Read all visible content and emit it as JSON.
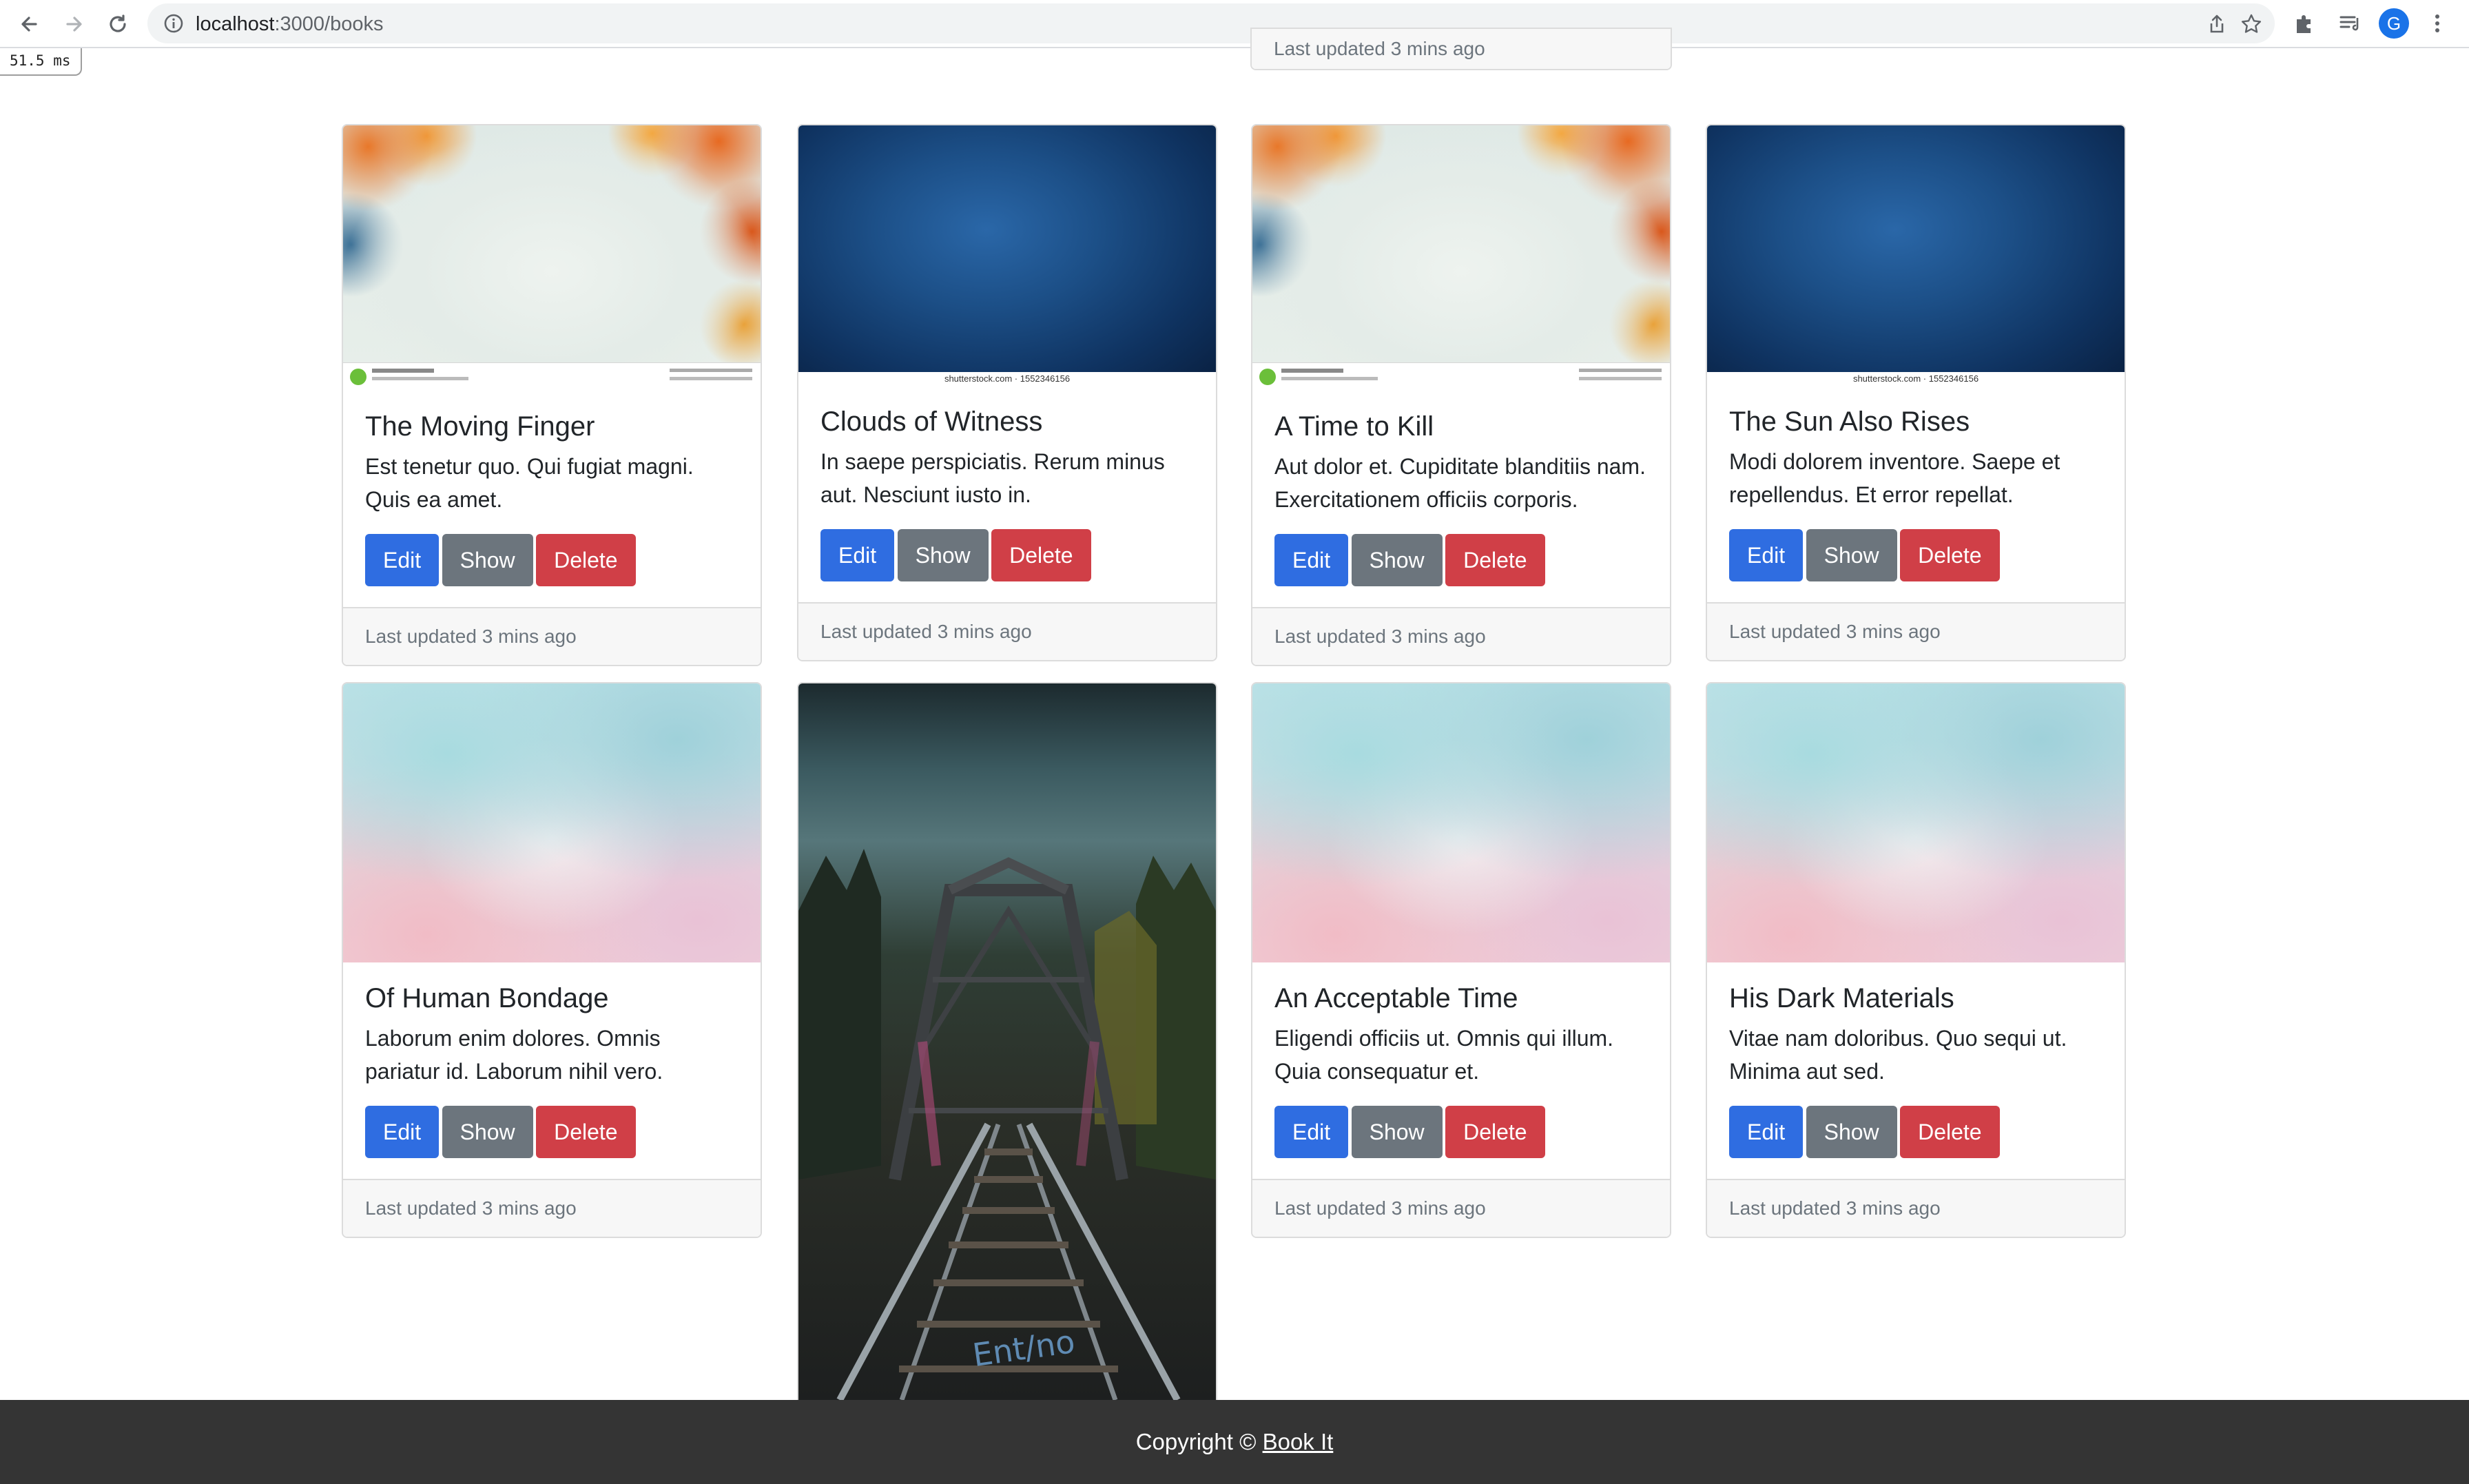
{
  "browser": {
    "url_host": "localhost",
    "url_path": ":3000/books",
    "avatar_letter": "G",
    "timing": "51.5 ms"
  },
  "top_partial_card": {
    "footer": "Last updated 3 mins ago"
  },
  "buttons": {
    "edit": "Edit",
    "show": "Show",
    "delete": "Delete"
  },
  "books": [
    {
      "title": "The Moving Finger",
      "text": "Est tenetur quo. Qui fugiat magni. Quis ea amet.",
      "updated": "Last updated 3 mins ago",
      "image": "autumn-leaves"
    },
    {
      "title": "Clouds of Witness",
      "text": "In saepe perspiciatis. Rerum minus aut. Nesciunt iusto in.",
      "updated": "Last updated 3 mins ago",
      "image": "blue-texture",
      "image_caption": "shutterstock.com · 1552346156"
    },
    {
      "title": "A Time to Kill",
      "text": "Aut dolor et. Cupiditate blanditiis nam. Exercitationem officiis corporis.",
      "updated": "Last updated 3 mins ago",
      "image": "autumn-leaves"
    },
    {
      "title": "The Sun Also Rises",
      "text": "Modi dolorem inventore. Saepe et repellendus. Et error repellat.",
      "updated": "Last updated 3 mins ago",
      "image": "blue-texture",
      "image_caption": "shutterstock.com · 1552346156"
    },
    {
      "title": "Of Human Bondage",
      "text": "Laborum enim dolores. Omnis pariatur id. Laborum nihil vero.",
      "updated": "Last updated 3 mins ago",
      "image": "pastel-clouds"
    },
    {
      "title": "An Acceptable Time",
      "text": "Eligendi officiis ut. Omnis qui illum. Quia consequatur et.",
      "updated": "Last updated 3 mins ago",
      "image": "pastel-clouds"
    },
    {
      "title": "His Dark Materials",
      "text": "Vitae nam doloribus. Quo sequi ut. Minima aut sed.",
      "updated": "Last updated 3 mins ago",
      "image": "pastel-clouds"
    }
  ],
  "bridge_card": {
    "image": "railway-bridge"
  },
  "footer": {
    "prefix": "Copyright ©",
    "brand": "Book It"
  }
}
